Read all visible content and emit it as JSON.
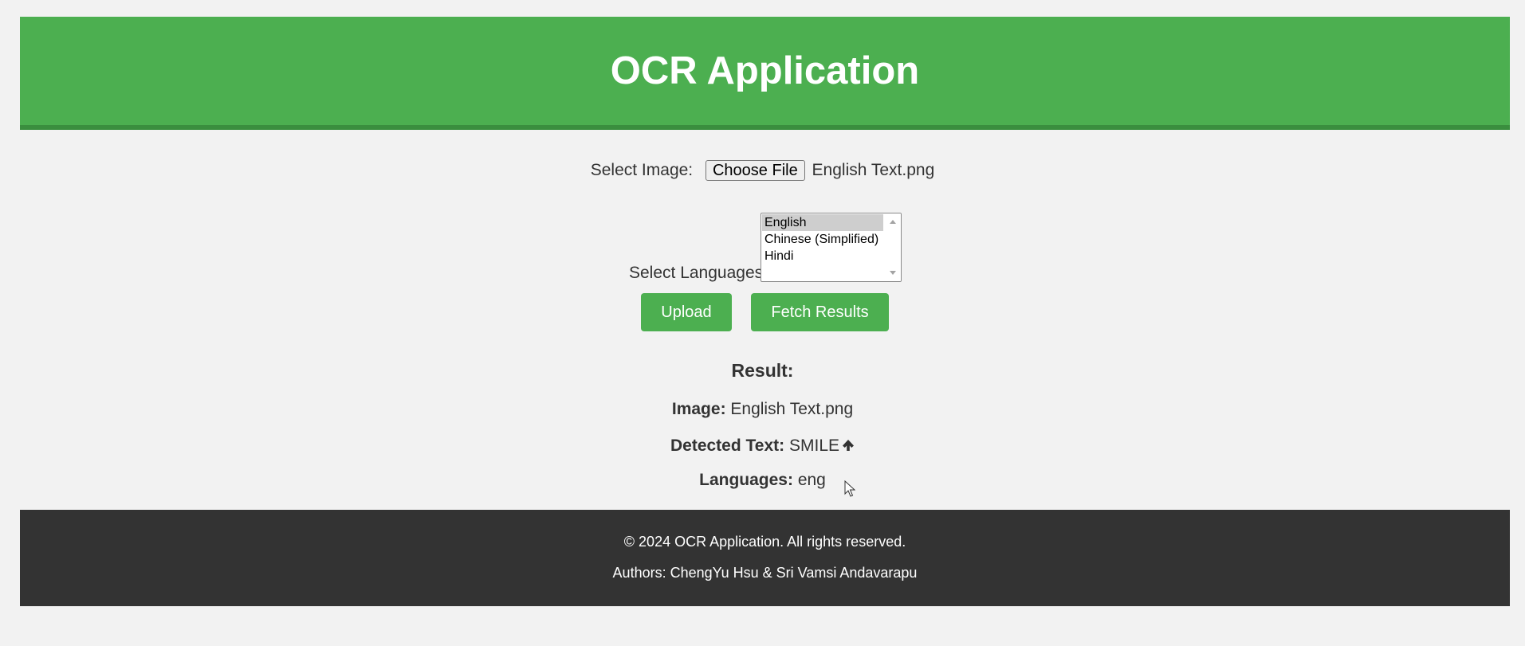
{
  "header": {
    "title": "OCR Application"
  },
  "form": {
    "image_label": "Select Image:",
    "choose_file_label": "Choose File",
    "file_name": "English Text.png",
    "languages_label": "Select Languages:",
    "language_options": [
      "English",
      "Chinese (Simplified)",
      "Hindi"
    ],
    "selected_language": "English",
    "upload_label": "Upload",
    "fetch_label": "Fetch Results"
  },
  "result": {
    "title": "Result:",
    "image_label": "Image:",
    "image_value": "English Text.png",
    "text_label": "Detected Text:",
    "text_value": "SMILE",
    "text_icon": "up-arrow-icon",
    "languages_label": "Languages:",
    "languages_value": "eng"
  },
  "footer": {
    "copyright": "© 2024 OCR Application. All rights reserved.",
    "authors": "Authors: ChengYu Hsu & Sri Vamsi Andavarapu"
  },
  "colors": {
    "brand_green": "#4caf50",
    "header_border": "#3a8e3e",
    "footer_bg": "#333333",
    "page_bg": "#f2f2f2"
  }
}
